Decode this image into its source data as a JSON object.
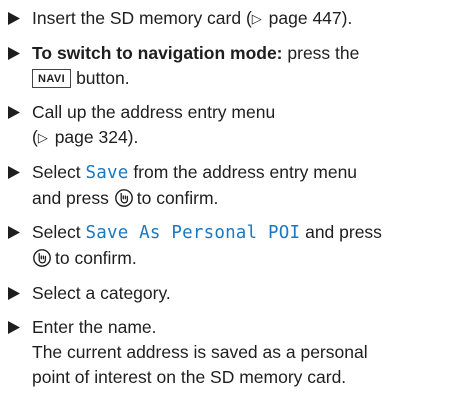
{
  "steps": [
    {
      "before": "Insert the SD memory card (",
      "arrow": "▷",
      "ref": " page 447)."
    },
    {
      "bold": "To switch to navigation mode:",
      "text1": " press the",
      "key": "NAVI",
      "text2": "button."
    },
    {
      "line1": "Call up the address entry menu",
      "arrow": "▷",
      "ref": " page 324)."
    },
    {
      "before": "Select ",
      "code": "Save",
      "after": " from the address entry menu",
      "line2": "and press",
      "line2_end": "to confirm."
    },
    {
      "before": "Select ",
      "code": "Save As Personal POI",
      "after": " and press",
      "line2_end": "to confirm."
    },
    {
      "text": "Select a category."
    },
    {
      "line1": "Enter the name.",
      "line2": "The current address is saved as a personal",
      "line3": "point of interest on the SD memory card."
    }
  ],
  "icons": {
    "bullet": "black-right-triangle",
    "confirm": "rotary-controller-press-icon"
  }
}
